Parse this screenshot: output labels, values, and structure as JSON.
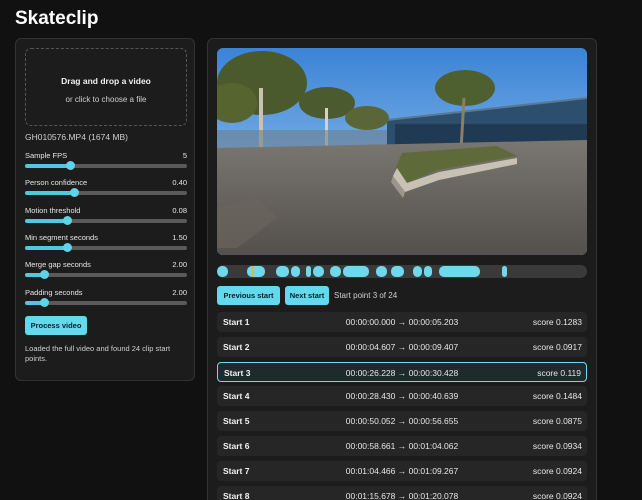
{
  "app": {
    "title": "Skateclip"
  },
  "upload": {
    "title": "Drag and drop a video",
    "subtitle": "or click to choose a file",
    "filename": "GH010576.MP4 (1674 MB)"
  },
  "settings": [
    {
      "label": "Sample FPS",
      "value": "5",
      "fraction": 0.28
    },
    {
      "label": "Person confidence",
      "value": "0.40",
      "fraction": 0.3
    },
    {
      "label": "Motion threshold",
      "value": "0.08",
      "fraction": 0.26
    },
    {
      "label": "Min segment seconds",
      "value": "1.50",
      "fraction": 0.26
    },
    {
      "label": "Merge gap seconds",
      "value": "2.00",
      "fraction": 0.12
    },
    {
      "label": "Padding seconds",
      "value": "2.00",
      "fraction": 0.12
    }
  ],
  "actions": {
    "process": "Process video"
  },
  "status": "Loaded the full video and found 24 clip start points.",
  "navigation": {
    "previous": "Previous start",
    "next": "Next start",
    "start_point": "Start point 3 of 24"
  },
  "timeline": {
    "segment_color": "#6fd8ec",
    "cursor_color": "#e8b53a",
    "segments": [
      [
        0.0,
        0.03
      ],
      [
        0.08,
        0.13
      ],
      [
        0.16,
        0.195
      ],
      [
        0.2,
        0.225
      ],
      [
        0.24,
        0.255
      ],
      [
        0.26,
        0.29
      ],
      [
        0.305,
        0.335
      ],
      [
        0.34,
        0.41
      ],
      [
        0.43,
        0.46
      ],
      [
        0.47,
        0.505
      ],
      [
        0.53,
        0.555
      ],
      [
        0.56,
        0.58
      ],
      [
        0.6,
        0.71
      ],
      [
        0.77,
        0.785
      ]
    ],
    "cursor": 0.095
  },
  "clips": [
    {
      "name": "Start 1",
      "range": "00:00:00.000 → 00:00:05.203",
      "score": "score 0.1283"
    },
    {
      "name": "Start 2",
      "range": "00:00:04.607 → 00:00:09.407",
      "score": "score 0.0917"
    },
    {
      "name": "Start 3",
      "range": "00:00:26.228 → 00:00:30.428",
      "score": "score 0.119",
      "active": true
    },
    {
      "name": "Start 4",
      "range": "00:00:28.430 → 00:00:40.639",
      "score": "score 0.1484"
    },
    {
      "name": "Start 5",
      "range": "00:00:50.052 → 00:00:56.655",
      "score": "score 0.0875"
    },
    {
      "name": "Start 6",
      "range": "00:00:58.661 → 00:01:04.062",
      "score": "score 0.0934"
    },
    {
      "name": "Start 7",
      "range": "00:01:04.466 → 00:01:09.267",
      "score": "score 0.0924"
    },
    {
      "name": "Start 8",
      "range": "00:01:15.678 → 00:01:20.078",
      "score": "score 0.0924"
    }
  ]
}
